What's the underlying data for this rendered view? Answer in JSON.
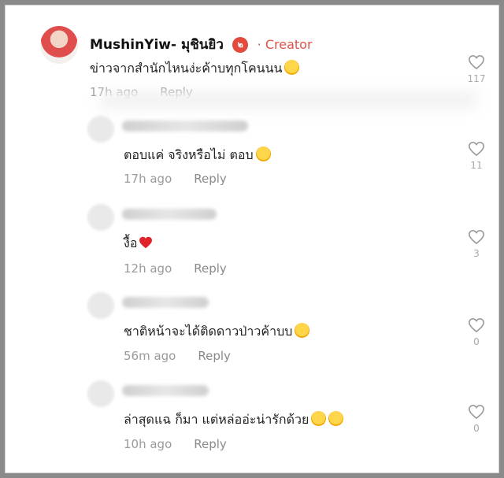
{
  "main_comment": {
    "author": "MushinYiw- มุชินยิว",
    "badge": "๒",
    "separator": "·",
    "creator_label": "Creator",
    "text": "ข่าวจากสำนักไหนง่ะค้าบทุกโคนนน",
    "time": "17h ago",
    "reply_label": "Reply",
    "likes": "117"
  },
  "replies": [
    {
      "text": "ตอบแค่ จริงหรือไม่ ตอบ",
      "time": "17h ago",
      "reply_label": "Reply",
      "likes": "11"
    },
    {
      "text": "งื้อ",
      "time": "12h ago",
      "reply_label": "Reply",
      "likes": "3"
    },
    {
      "text": "ชาติหน้าจะได้ติดดาวป่าวค้าบบ",
      "time": "56m ago",
      "reply_label": "Reply",
      "likes": "0"
    },
    {
      "text": "ล่าสุดแฉ ก็มา แต่หล่ออ่ะน่ารักด้วย",
      "time": "10h ago",
      "reply_label": "Reply",
      "likes": "0"
    }
  ],
  "icons": {
    "like": "heart-outline-icon",
    "emoji_laugh": "laughing-emoji-icon",
    "emoji_heart": "red-heart-emoji-icon",
    "emoji_love": "smiling-hearts-emoji-icon"
  },
  "colors": {
    "creator": "#e2524a",
    "muted": "#9a9a9a",
    "text": "#222222"
  }
}
